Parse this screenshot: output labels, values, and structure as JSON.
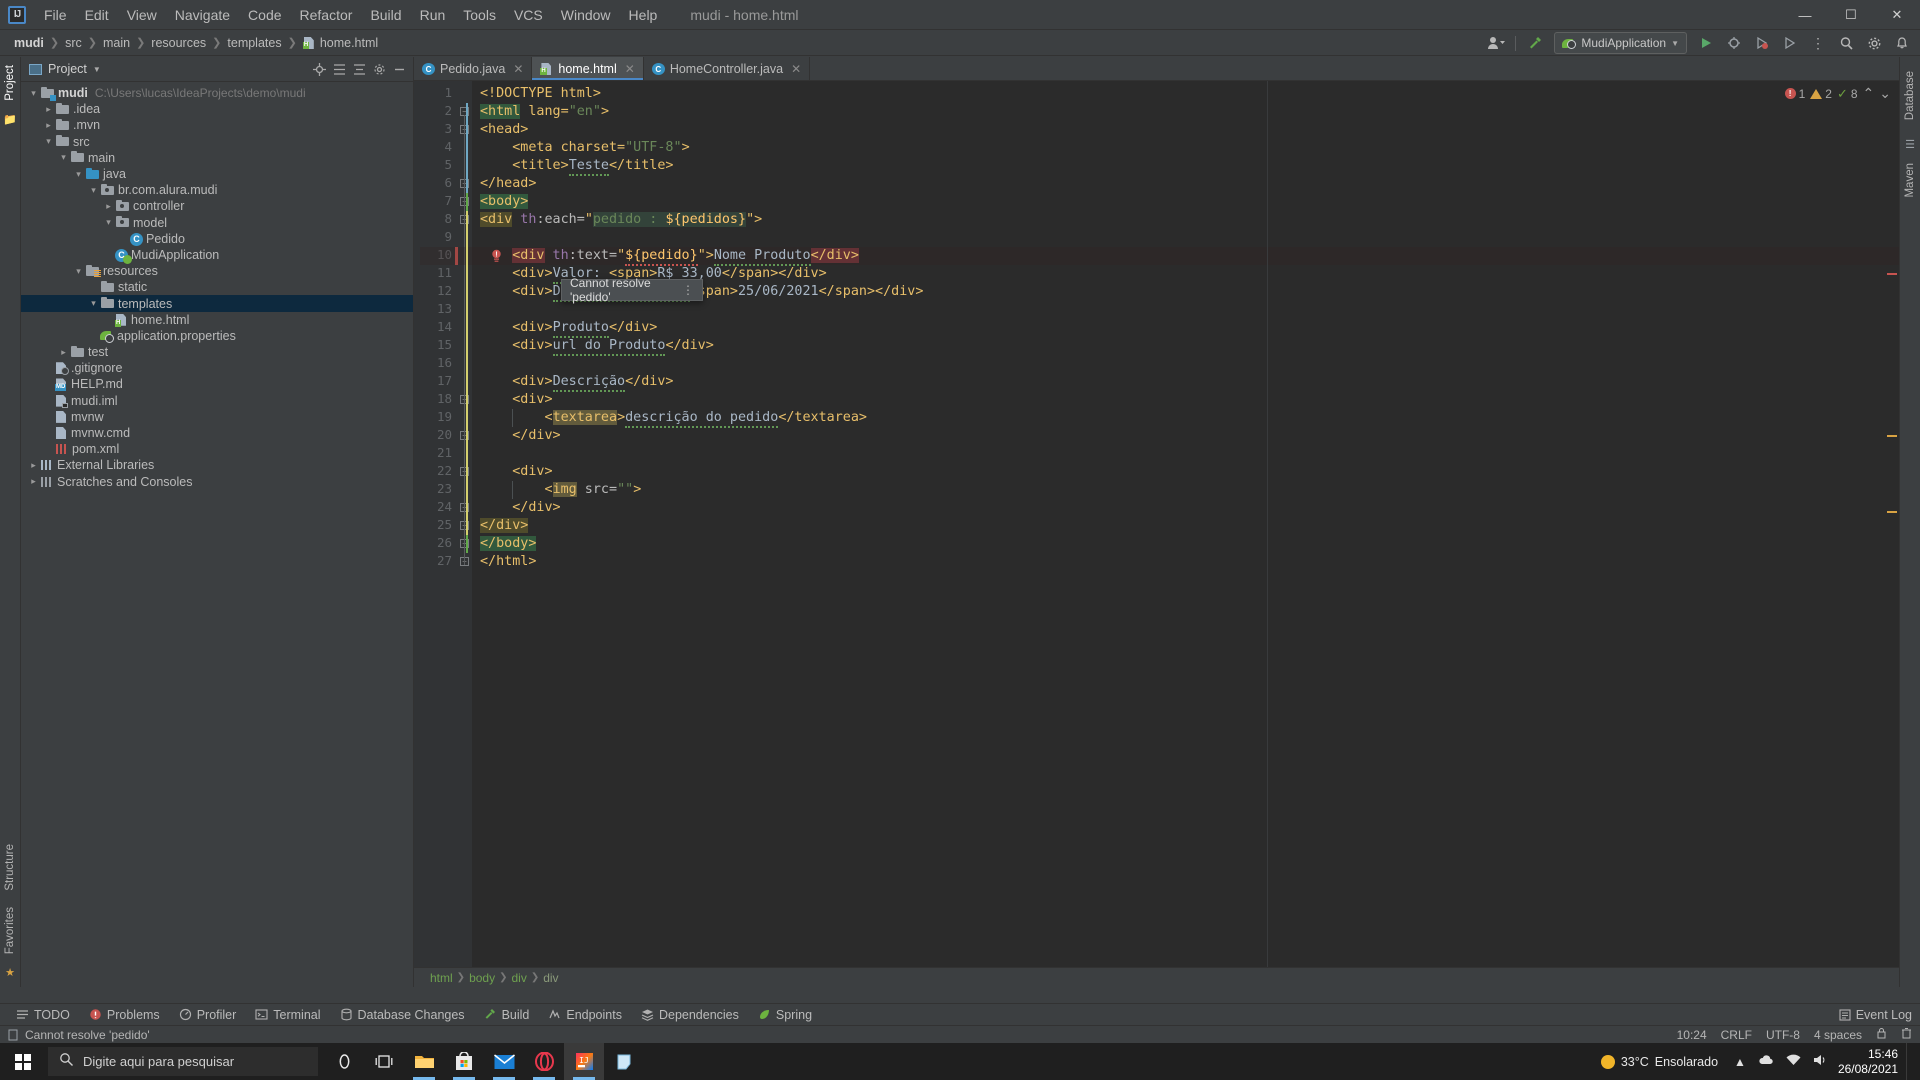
{
  "window": {
    "title": "mudi - home.html",
    "minimize": "—",
    "maximize": "☐",
    "close": "✕"
  },
  "menu": {
    "items": [
      "File",
      "Edit",
      "View",
      "Navigate",
      "Code",
      "Refactor",
      "Build",
      "Run",
      "Tools",
      "VCS",
      "Window",
      "Help"
    ]
  },
  "navbar": {
    "crumbs": [
      "mudi",
      "src",
      "main",
      "resources",
      "templates",
      "home.html"
    ],
    "run_config": "MudiApplication",
    "icons": [
      "user-dropdown-icon",
      "hammer-icon",
      "run-icon",
      "debug-icon",
      "coverage-icon",
      "profiler-icon",
      "more-icon",
      "search-icon",
      "settings-icon",
      "notifications-icon"
    ]
  },
  "project_panel": {
    "title": "Project",
    "vertical_tabs": [
      "Project",
      "Structure",
      "Favorites"
    ],
    "header_icons": [
      "locate-icon",
      "expand-all-icon",
      "collapse-all-icon",
      "settings-icon",
      "hide-icon"
    ],
    "tree": [
      {
        "depth": 0,
        "arrow": "open",
        "icon": "folder-module",
        "label": "mudi",
        "bold": true,
        "sub": "C:\\Users\\lucas\\IdeaProjects\\demo\\mudi"
      },
      {
        "depth": 1,
        "arrow": "closed",
        "icon": "folder",
        "label": ".idea"
      },
      {
        "depth": 1,
        "arrow": "closed",
        "icon": "folder",
        "label": ".mvn"
      },
      {
        "depth": 1,
        "arrow": "open",
        "icon": "folder",
        "label": "src"
      },
      {
        "depth": 2,
        "arrow": "open",
        "icon": "folder",
        "label": "main"
      },
      {
        "depth": 3,
        "arrow": "open",
        "icon": "folder-source",
        "label": "java"
      },
      {
        "depth": 4,
        "arrow": "open",
        "icon": "package",
        "label": "br.com.alura.mudi"
      },
      {
        "depth": 5,
        "arrow": "closed",
        "icon": "package",
        "label": "controller"
      },
      {
        "depth": 5,
        "arrow": "open",
        "icon": "package",
        "label": "model"
      },
      {
        "depth": 6,
        "arrow": "none",
        "icon": "class",
        "label": "Pedido"
      },
      {
        "depth": 5,
        "arrow": "none",
        "icon": "spring-class",
        "label": "MudiApplication"
      },
      {
        "depth": 3,
        "arrow": "open",
        "icon": "folder-resource",
        "label": "resources"
      },
      {
        "depth": 4,
        "arrow": "none",
        "icon": "folder",
        "label": "static"
      },
      {
        "depth": 4,
        "arrow": "open",
        "icon": "folder",
        "label": "templates",
        "selected": true
      },
      {
        "depth": 5,
        "arrow": "none",
        "icon": "file-html",
        "label": "home.html"
      },
      {
        "depth": 4,
        "arrow": "none",
        "icon": "spring-properties",
        "label": "application.properties"
      },
      {
        "depth": 2,
        "arrow": "closed",
        "icon": "folder",
        "label": "test"
      },
      {
        "depth": 1,
        "arrow": "none",
        "icon": "file-ignore",
        "label": ".gitignore"
      },
      {
        "depth": 1,
        "arrow": "none",
        "icon": "file-md",
        "label": "HELP.md"
      },
      {
        "depth": 1,
        "arrow": "none",
        "icon": "file-iml",
        "label": "mudi.iml"
      },
      {
        "depth": 1,
        "arrow": "none",
        "icon": "file-script",
        "label": "mvnw"
      },
      {
        "depth": 1,
        "arrow": "none",
        "icon": "file-script",
        "label": "mvnw.cmd"
      },
      {
        "depth": 1,
        "arrow": "none",
        "icon": "file-maven",
        "label": "pom.xml"
      },
      {
        "depth": 0,
        "arrow": "closed",
        "icon": "library",
        "label": "External Libraries"
      },
      {
        "depth": 0,
        "arrow": "closed",
        "icon": "scratch",
        "label": "Scratches and Consoles"
      }
    ]
  },
  "editor": {
    "tabs": [
      {
        "label": "Pedido.java",
        "icon": "java-class-icon",
        "active": false
      },
      {
        "label": "home.html",
        "icon": "html-file-icon",
        "active": true
      },
      {
        "label": "HomeController.java",
        "icon": "java-class-icon",
        "active": false
      }
    ],
    "line_numbers": [
      1,
      2,
      3,
      4,
      5,
      6,
      7,
      8,
      9,
      10,
      11,
      12,
      13,
      14,
      15,
      16,
      17,
      18,
      19,
      20,
      21,
      22,
      23,
      24,
      25,
      26,
      27
    ],
    "code_lines": [
      "<!DOCTYPE html>",
      "<html lang=\"en\">",
      "<head>",
      "    <meta charset=\"UTF-8\">",
      "    <title>Teste</title>",
      "</head>",
      "<body>",
      "<div th:each=\"pedido : ${pedidos}\">",
      "",
      "    <div th:text=\"${pedido}\">Nome Produto</div>",
      "    <div>Valor: <span>R$ 33,00</span></div>",
      "    <div>Data de entrega: <span>25/06/2021</span></div>",
      "",
      "    <div>Produto</div>",
      "    <div>url do Produto</div>",
      "",
      "    <div>Descrição</div>",
      "    <div>",
      "        <textarea>descrição do pedido</textarea>",
      "    </div>",
      "",
      "    <div>",
      "        <img src=\"\">",
      "    </div>",
      "</div>",
      "</body>",
      "</html>"
    ],
    "tooltip": "Cannot resolve 'pedido'",
    "tooltip_more": "⋮",
    "inspection": {
      "errors": "1",
      "warnings": "2",
      "oks": "8",
      "chevron_up": "⌃",
      "chevron_down": "⌄"
    },
    "breadcrumbs": [
      "html",
      "body",
      "div",
      "div"
    ]
  },
  "toolwindows": {
    "items": [
      {
        "label": "TODO",
        "icon": "todo-icon"
      },
      {
        "label": "Problems",
        "icon": "problems-icon"
      },
      {
        "label": "Profiler",
        "icon": "profiler-icon"
      },
      {
        "label": "Terminal",
        "icon": "terminal-icon"
      },
      {
        "label": "Database Changes",
        "icon": "database-icon"
      },
      {
        "label": "Build",
        "icon": "build-hammer-icon"
      },
      {
        "label": "Endpoints",
        "icon": "endpoints-icon"
      },
      {
        "label": "Dependencies",
        "icon": "dependencies-icon"
      },
      {
        "label": "Spring",
        "icon": "spring-leaf-icon"
      }
    ],
    "event_log": "Event Log"
  },
  "statusbar": {
    "message": "Cannot resolve 'pedido'",
    "caret": "10:24",
    "line_sep": "CRLF",
    "encoding": "UTF-8",
    "indent": "4 spaces",
    "lock_icon": "lock-icon"
  },
  "right_strip": {
    "tabs": [
      "Database",
      "Maven"
    ]
  },
  "taskbar": {
    "search_placeholder": "Digite aqui para pesquisar",
    "icons": [
      "cortana-icon",
      "task-view-icon",
      "file-explorer-icon",
      "microsoft-store-icon",
      "mail-icon",
      "opera-icon",
      "intellij-icon",
      "sticky-notes-icon"
    ],
    "weather_temp": "33°C",
    "weather_desc": "Ensolarado",
    "tray_icons": [
      "chevron-up-icon",
      "onedrive-icon",
      "network-icon",
      "volume-icon"
    ],
    "time": "15:46",
    "date": "26/08/2021"
  }
}
